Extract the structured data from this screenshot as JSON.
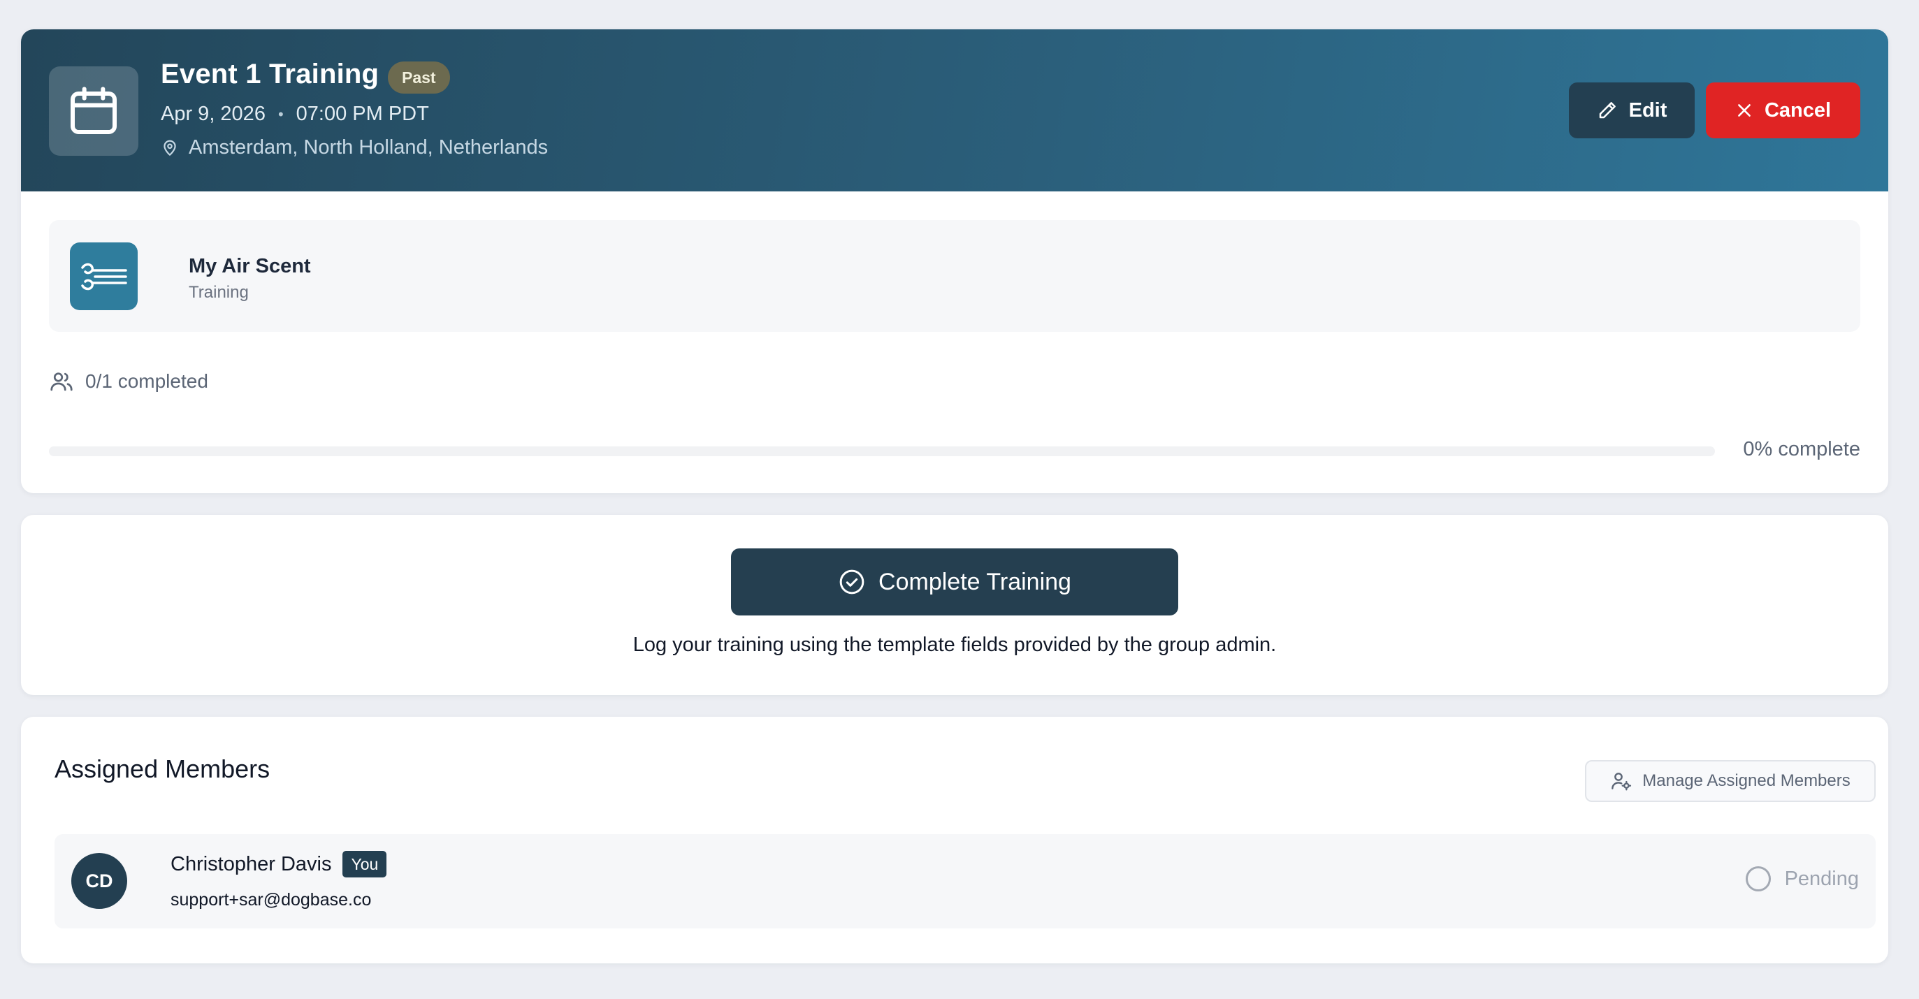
{
  "event": {
    "title": "Event 1 Training",
    "status_badge": "Past",
    "date": "Apr 9, 2026",
    "separator": "•",
    "time": "07:00 PM PDT",
    "location": "Amsterdam, North Holland, Netherlands",
    "edit_label": "Edit",
    "cancel_label": "Cancel"
  },
  "activity": {
    "name": "My Air Scent",
    "type": "Training",
    "icon": "wind-icon"
  },
  "progress": {
    "completed_text": "0/1 completed",
    "completed": 0,
    "total": 1,
    "percent": 0,
    "percent_label": "0% complete"
  },
  "complete_section": {
    "button_label": "Complete Training",
    "hint": "Log your training using the template fields provided by the group admin."
  },
  "members": {
    "title": "Assigned Members",
    "manage_label": "Manage Assigned Members",
    "list": [
      {
        "initials": "CD",
        "name": "Christopher Davis",
        "badge": "You",
        "email": "support+sar@dogbase.co",
        "status": "Pending"
      }
    ]
  },
  "colors": {
    "header_gradient_start": "#23465a",
    "header_gradient_end": "#2f7699",
    "primary_dark": "#233f51",
    "danger": "#e02424",
    "activity_accent": "#2f7d9d",
    "past_badge": "#6c6a4f"
  }
}
